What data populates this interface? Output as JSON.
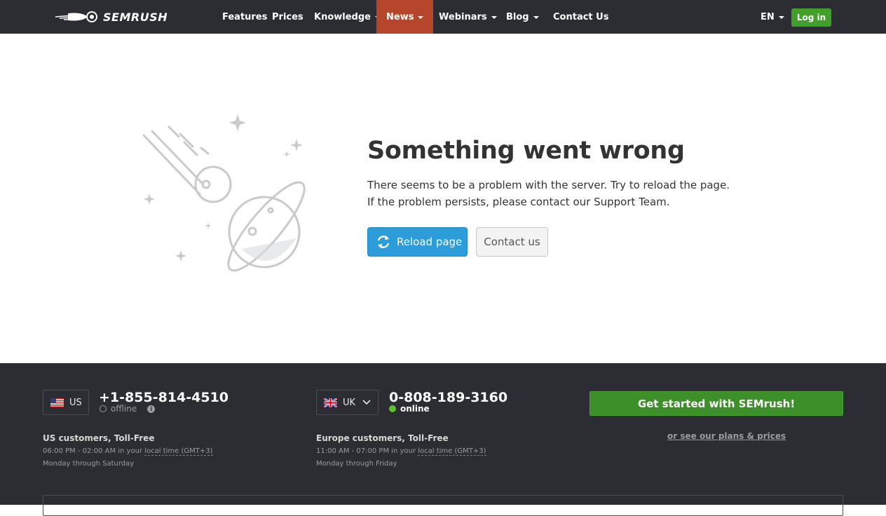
{
  "nav": {
    "logo_text": "SEMRUSH",
    "items": [
      {
        "label": "Features",
        "dropdown": false
      },
      {
        "label": "Prices",
        "dropdown": false
      },
      {
        "label": "Knowledge",
        "dropdown": true
      },
      {
        "label": "News",
        "dropdown": true,
        "active": true
      },
      {
        "label": "Webinars",
        "dropdown": true
      },
      {
        "label": "Blog",
        "dropdown": true
      },
      {
        "label": "Contact Us",
        "dropdown": false
      }
    ],
    "language": "EN",
    "login_label": "Log in"
  },
  "error": {
    "title": "Something went wrong",
    "line1": "There seems to be a problem with the server. Try to reload the page.",
    "line2": "If the problem persists, please contact our Support Team.",
    "reload_label": "Reload page",
    "contact_label": "Contact us"
  },
  "footer": {
    "us": {
      "country": "US",
      "phone": "+1-855-814-4510",
      "status": "offline",
      "heading": "US customers, Toll-Free",
      "hours_prefix": "06:00 PM - 02:00 AM in your ",
      "hours_link": "local time (GMT+3)",
      "days": "Monday through Saturday"
    },
    "uk": {
      "country": "UK",
      "phone": "0-808-189-3160",
      "status": "online",
      "heading": "Europe customers, Toll-Free",
      "hours_prefix": "11:00 AM - 07:00 PM in your ",
      "hours_link": "local time (GMT+3)",
      "days": "Monday through Friday"
    },
    "cta_label": "Get started with SEMrush!",
    "plans_link": "or see our plans & prices"
  },
  "colors": {
    "nav_bg": "#2b2d33",
    "active_nav": "#b5452b",
    "login_green": "#41a029",
    "reload_blue": "#2d9cdb",
    "online_green": "#5fbf2e"
  }
}
